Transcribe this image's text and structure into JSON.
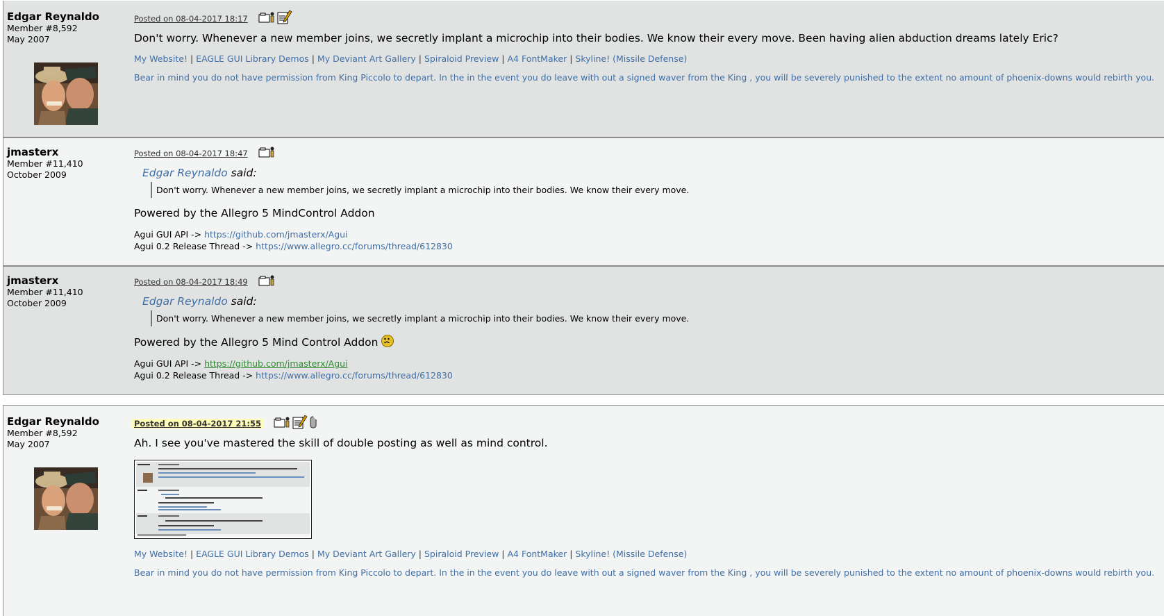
{
  "posts": [
    {
      "author": "Edgar Reynaldo",
      "member": "Member #8,592",
      "joined": "May 2007",
      "posted": "Posted on 08-04-2017 18:17",
      "message": "Don't worry. Whenever a new member joins, we secretly implant a microchip into their bodies. We know their every move. Been having alien abduction dreams lately Eric?",
      "links": [
        "My Website!",
        "EAGLE GUI Library Demos",
        "My Deviant Art Gallery",
        "Spiraloid Preview",
        "A4 FontMaker",
        "Skyline! (Missile Defense)"
      ],
      "signature": "Bear in mind you do not have permission from King Piccolo to depart. In the in the event you do leave with out a signed waver from the King , you will be severely punished to the extent no amount of phoenix-downs would rebirth you."
    },
    {
      "author": "jmasterx",
      "member": "Member #11,410",
      "joined": "October 2009",
      "posted": "Posted on 08-04-2017 18:47",
      "quote_author": "Edgar Reynaldo",
      "quote_said": "said:",
      "quote": "Don't worry. Whenever a new member joins, we secretly implant a microchip into their bodies. We know their every move.",
      "message": "Powered by the Allegro 5 MindControl Addon",
      "api_label": "Agui GUI API ->",
      "api_link": "https://github.com/jmasterx/Agui",
      "thread_label": "Agui 0.2 Release Thread ->",
      "thread_link": "https://www.allegro.cc/forums/thread/612830"
    },
    {
      "author": "jmasterx",
      "member": "Member #11,410",
      "joined": "October 2009",
      "posted": "Posted on 08-04-2017 18:49",
      "quote_author": "Edgar Reynaldo",
      "quote_said": "said:",
      "quote": "Don't worry. Whenever a new member joins, we secretly implant a microchip into their bodies. We know their every move.",
      "message": "Powered by the Allegro 5 Mind Control Addon",
      "api_label": "Agui GUI API ->",
      "api_link": "https://github.com/jmasterx/Agui",
      "thread_label": "Agui 0.2 Release Thread ->",
      "thread_link": "https://www.allegro.cc/forums/thread/612830"
    },
    {
      "author": "Edgar Reynaldo",
      "member": "Member #8,592",
      "joined": "May 2007",
      "posted": "Posted on 08-04-2017 21:55",
      "message": "Ah. I see you've mastered the skill of double posting as well as mind control.",
      "links": [
        "My Website!",
        "EAGLE GUI Library Demos",
        "My Deviant Art Gallery",
        "Spiraloid Preview",
        "A4 FontMaker",
        "Skyline! (Missile Defense)"
      ],
      "signature": "Bear in mind you do not have permission from King Piccolo to depart. In the in the event you do leave with out a signed waver from the King , you will be severely punished to the extent no amount of phoenix-downs would rebirth you."
    }
  ],
  "colors": {
    "link": "#3f6ea5",
    "post_gray": "#e1e3e3",
    "post_light": "#f3f4f4",
    "highlight": "#fffcb7",
    "visited_link": "#2f8c2f"
  }
}
